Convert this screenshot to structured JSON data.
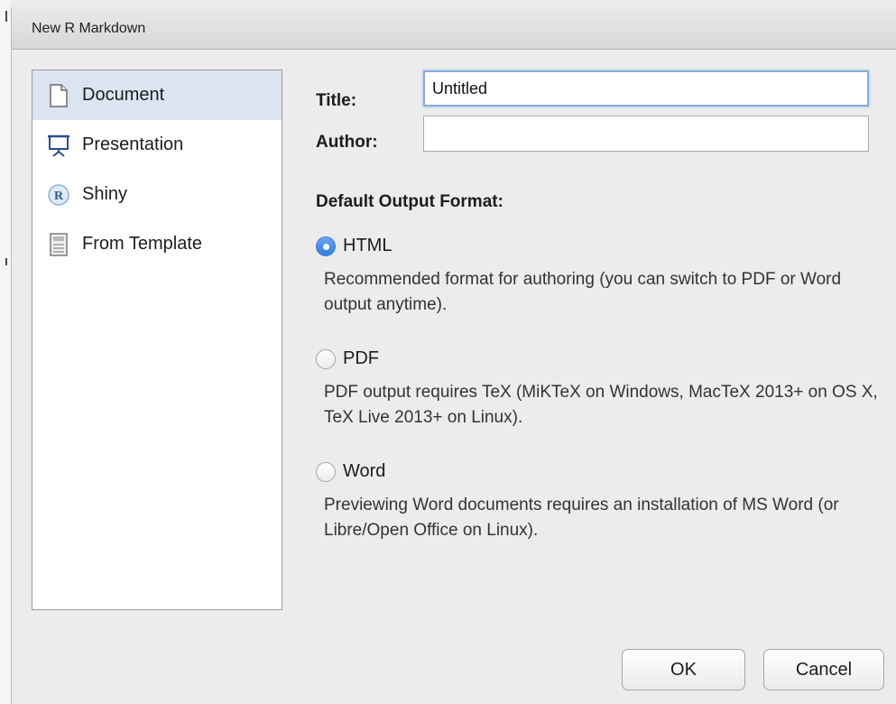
{
  "window": {
    "title": "New R Markdown"
  },
  "sidebar": {
    "items": [
      {
        "label": "Document",
        "icon": "document-icon",
        "selected": true
      },
      {
        "label": "Presentation",
        "icon": "presentation-icon",
        "selected": false
      },
      {
        "label": "Shiny",
        "icon": "shiny-icon",
        "selected": false
      },
      {
        "label": "From Template",
        "icon": "template-icon",
        "selected": false
      }
    ]
  },
  "form": {
    "title_label": "Title:",
    "title_value": "Untitled",
    "author_label": "Author:",
    "author_value": ""
  },
  "output": {
    "section_title": "Default Output Format:",
    "options": [
      {
        "label": "HTML",
        "checked": true,
        "description": "Recommended format for authoring (you can switch to PDF or Word output anytime)."
      },
      {
        "label": "PDF",
        "checked": false,
        "description": "PDF output requires TeX (MiKTeX on Windows, MacTeX 2013+ on OS X, TeX Live 2013+ on Linux)."
      },
      {
        "label": "Word",
        "checked": false,
        "description": "Previewing Word documents requires an installation of MS Word (or Libre/Open Office on Linux)."
      }
    ]
  },
  "buttons": {
    "ok_label": "OK",
    "cancel_label": "Cancel"
  },
  "colors": {
    "selection": "#dbe5f1",
    "radio_checked": "#2f7de0",
    "focus_ring": "#86aee0"
  }
}
